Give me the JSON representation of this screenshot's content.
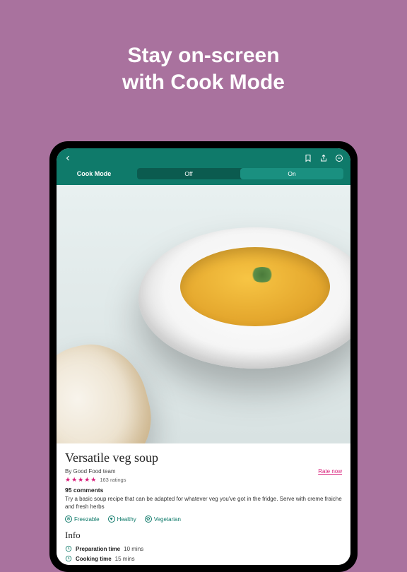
{
  "headline": {
    "line1": "Stay on-screen",
    "line2": "with Cook Mode"
  },
  "modebar": {
    "label": "Cook Mode",
    "off": "Off",
    "on": "On"
  },
  "recipe": {
    "title": "Versatile veg soup",
    "byline": "By Good Food team",
    "rate_now": "Rate now",
    "rating_count": "163 ratings",
    "comments": "95 comments",
    "description": "Try a basic soup recipe that can be adapted for whatever veg you've got in the fridge. Serve with creme fraiche and fresh herbs",
    "tags": {
      "freezable": "Freezable",
      "healthy": "Healthy",
      "vegetarian": "Vegetarian"
    },
    "info_heading": "Info",
    "prep": {
      "label": "Preparation time",
      "value": "10 mins"
    },
    "cook": {
      "label": "Cooking time",
      "value": "15 mins"
    }
  }
}
